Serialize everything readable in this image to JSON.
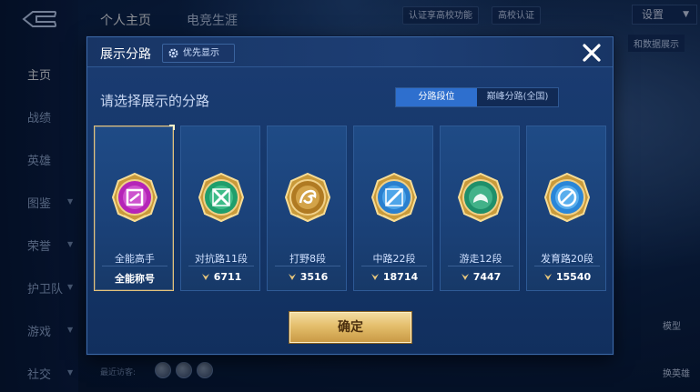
{
  "top_tabs": [
    "个人主页",
    "电竞生涯"
  ],
  "top_bar": {
    "school_promo": "认证享高校功能",
    "school_verify": "高校认证",
    "settings_label": "设置",
    "right_tag": "和数据展示"
  },
  "left_nav": {
    "items": [
      {
        "label": "主页",
        "active": true,
        "has_arrow": false
      },
      {
        "label": "战绩",
        "active": false,
        "has_arrow": false
      },
      {
        "label": "英雄",
        "active": false,
        "has_arrow": false
      },
      {
        "label": "图鉴",
        "active": false,
        "has_arrow": true
      },
      {
        "label": "荣誉",
        "active": false,
        "has_arrow": true
      },
      {
        "label": "护卫队",
        "active": false,
        "has_arrow": true
      },
      {
        "label": "游戏",
        "active": false,
        "has_arrow": true
      },
      {
        "label": "社交",
        "active": false,
        "has_arrow": true
      }
    ]
  },
  "right_side": {
    "model_label": "模型",
    "swap_label": "换英雄"
  },
  "recent_visitors_label": "最近访客:",
  "modal": {
    "title": "展示分路",
    "priority_label": "优先显示",
    "subtitle": "请选择展示的分路",
    "toggle": {
      "options": [
        "分路段位",
        "巅峰分路(全国)"
      ],
      "selected_index": 0
    },
    "cards": [
      {
        "name": "全能高手",
        "footer_text": "全能称号",
        "power": null,
        "selected": true,
        "badge_color": "#b524b8",
        "badge_inner": "#e07ae0",
        "icon": "all-round-icon"
      },
      {
        "name": "对抗路11段",
        "footer_text": null,
        "power": "6711",
        "selected": false,
        "badge_color": "#1f9e6c",
        "badge_inner": "#58d6a0",
        "icon": "clash-lane-icon"
      },
      {
        "name": "打野8段",
        "footer_text": null,
        "power": "3516",
        "selected": false,
        "badge_color": "#b07a22",
        "badge_inner": "#f0c46a",
        "icon": "jungle-icon"
      },
      {
        "name": "中路22段",
        "footer_text": null,
        "power": "18714",
        "selected": false,
        "badge_color": "#2a7fcf",
        "badge_inner": "#6cc4ff",
        "icon": "mid-lane-icon"
      },
      {
        "name": "游走12段",
        "footer_text": null,
        "power": "7447",
        "selected": false,
        "badge_color": "#1f8f6a",
        "badge_inner": "#5fd0a2",
        "icon": "roam-icon"
      },
      {
        "name": "发育路20段",
        "footer_text": null,
        "power": "15540",
        "selected": false,
        "badge_color": "#2a86d8",
        "badge_inner": "#7fd0ff",
        "icon": "farm-lane-icon"
      }
    ],
    "confirm_label": "确定"
  }
}
